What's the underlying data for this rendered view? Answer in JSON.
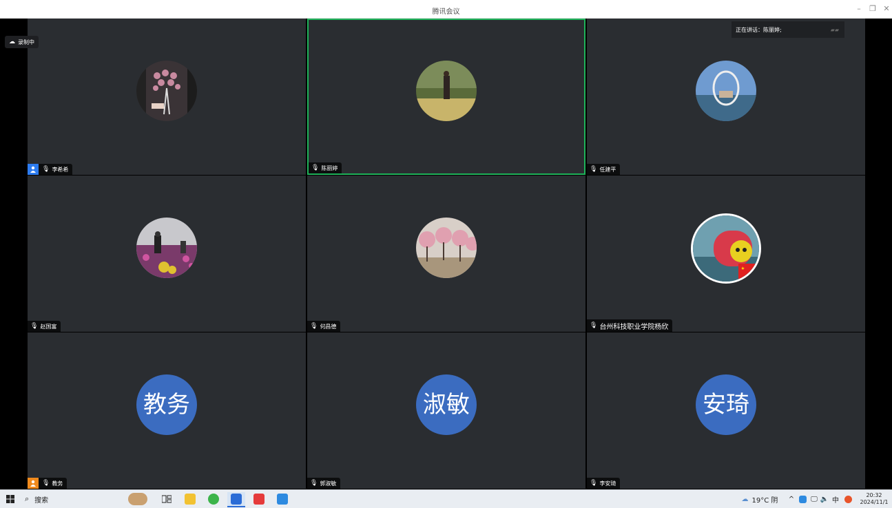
{
  "window": {
    "title": "腾讯会议"
  },
  "recording": {
    "label": "录制中"
  },
  "speaking": {
    "label": "正在讲话：",
    "name": "陈丽婷;"
  },
  "participants": [
    {
      "name": "李希希",
      "host": true,
      "host_color": "#2d7cf0",
      "avatar": "photo-flowers",
      "active": false
    },
    {
      "name": "陈丽婷",
      "host": false,
      "avatar": "photo-woman-field",
      "active": true
    },
    {
      "name": "任建平",
      "host": false,
      "avatar": "photo-bubble-chair",
      "active": false
    },
    {
      "name": "赵国富",
      "host": false,
      "avatar": "photo-flower-garden",
      "active": false
    },
    {
      "name": "何昌德",
      "host": false,
      "avatar": "photo-blossom-orchard",
      "active": false
    },
    {
      "name": "台州科技职业学院杨欣",
      "host": false,
      "avatar": "photo-toy-train",
      "active": false
    },
    {
      "name": "教务",
      "host": true,
      "host_color": "#f08a1d",
      "initials": "教务",
      "active": false
    },
    {
      "name": "郭淑敏",
      "host": false,
      "initials": "淑敏",
      "active": false
    },
    {
      "name": "李安琦",
      "host": false,
      "initials": "安琦",
      "active": false
    }
  ],
  "taskbar": {
    "search_label": "搜索",
    "weather": "19°C 阴",
    "time": "20:32",
    "date": "2024/11/1",
    "ime": "中"
  },
  "colors": {
    "accent_green": "#1fb35a",
    "tile_bg": "#2a2d31",
    "initials_bg": "#3b6cc0"
  }
}
